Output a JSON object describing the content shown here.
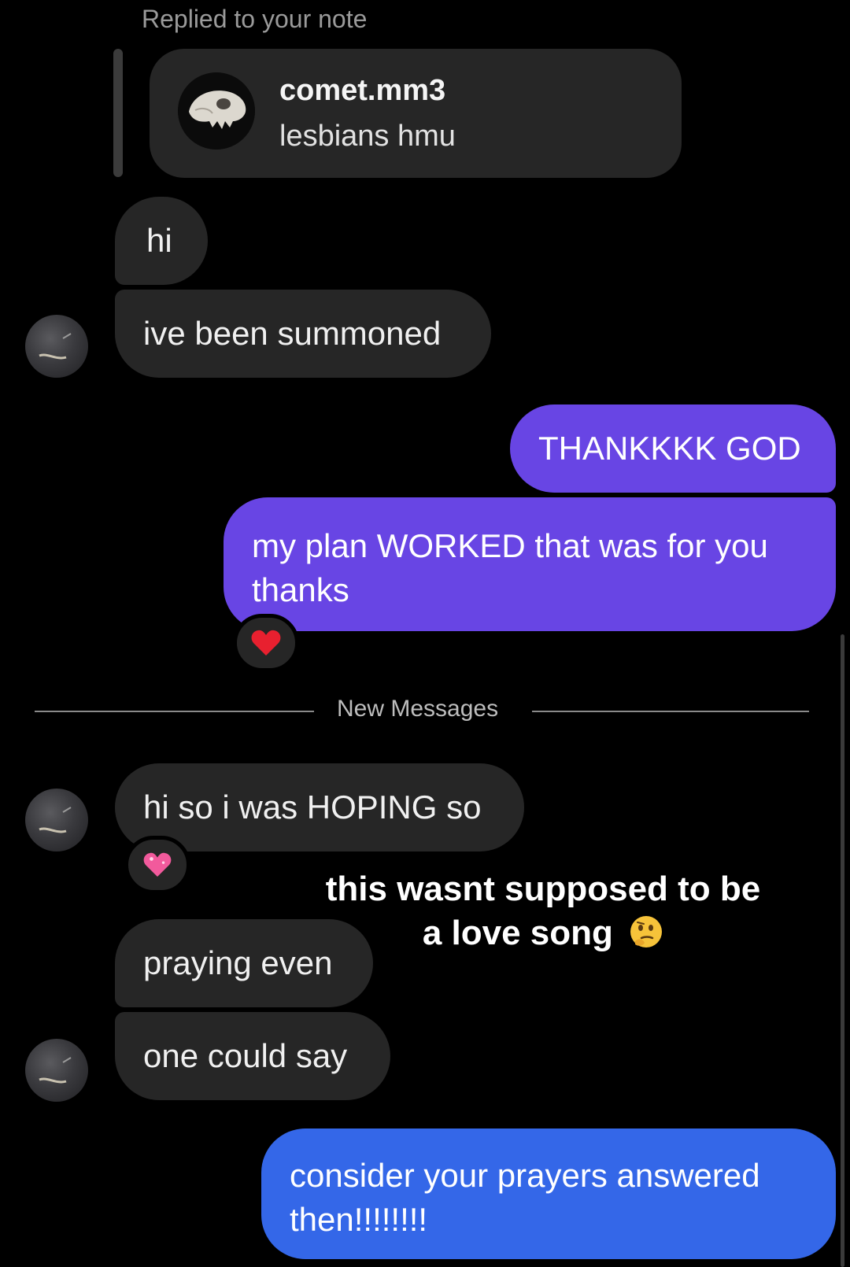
{
  "note_reply": {
    "caption": "Replied to your note",
    "username": "comet.mm3",
    "note_text": "lesbians hmu"
  },
  "messages": [
    {
      "text": "hi",
      "direction": "incoming"
    },
    {
      "text": "ive been summoned",
      "direction": "incoming"
    },
    {
      "text": "THANKKKK GOD",
      "direction": "outgoing"
    },
    {
      "text": "my plan WORKED that was for you thanks",
      "line1": "my plan WORKED that was for you",
      "line2": "thanks",
      "direction": "outgoing",
      "reaction": "heart"
    },
    {
      "text": "hi so i was HOPING so",
      "direction": "incoming",
      "reaction": "sparkling-heart"
    },
    {
      "text": "praying even",
      "direction": "incoming"
    },
    {
      "text": "one could say",
      "direction": "incoming"
    },
    {
      "text": "consider your prayers answered then!!!!!!!!",
      "line1": "consider your prayers answered",
      "line2": "then!!!!!!!!",
      "direction": "outgoing"
    }
  ],
  "divider": {
    "label": "New Messages"
  },
  "overlay": {
    "line1": "this wasnt supposed to be",
    "line2": "a love song",
    "emoji": "thinking-face"
  },
  "colors": {
    "background": "#000000",
    "incoming_bubble": "#262626",
    "outgoing_purple": "#6845e4",
    "outgoing_blue": "#3467e8"
  }
}
